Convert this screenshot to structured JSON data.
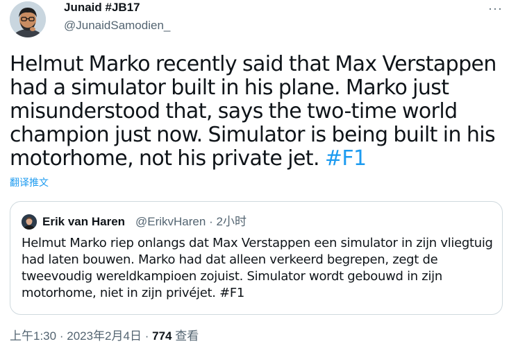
{
  "author": {
    "display_name": "Junaid #JB17",
    "handle": "@JunaidSamodien_"
  },
  "menu": {
    "more_label": "···"
  },
  "tweet": {
    "text": "Helmut Marko recently said that Max Verstappen had a simulator built in his plane. Marko just misunderstood that, says the two-time world champion just now. Simulator is being built in his motorhome, not his private jet.",
    "hashtag": "#F1"
  },
  "translate_label": "翻译推文",
  "quoted_tweet": {
    "display_name": "Erik van Haren",
    "handle": "@ErikvHaren",
    "separator": "·",
    "time": "2小时",
    "text": "Helmut Marko riep onlangs dat Max Verstappen een simulator in zijn vliegtuig had laten bouwen. Marko had dat alleen verkeerd begrepen, zegt de tweevoudig wereldkampioen zojuist. Simulator wordt gebouwd in zijn motorhome, niet in zijn privéjet. #F1"
  },
  "meta": {
    "time": "上午1:30",
    "separator": "·",
    "date": "2023年2月4日",
    "views_count": "774",
    "views_label": "查看"
  },
  "colors": {
    "accent": "#1d9bf0",
    "text_primary": "#0f1419",
    "text_secondary": "#536471",
    "border": "#cfd9de"
  }
}
